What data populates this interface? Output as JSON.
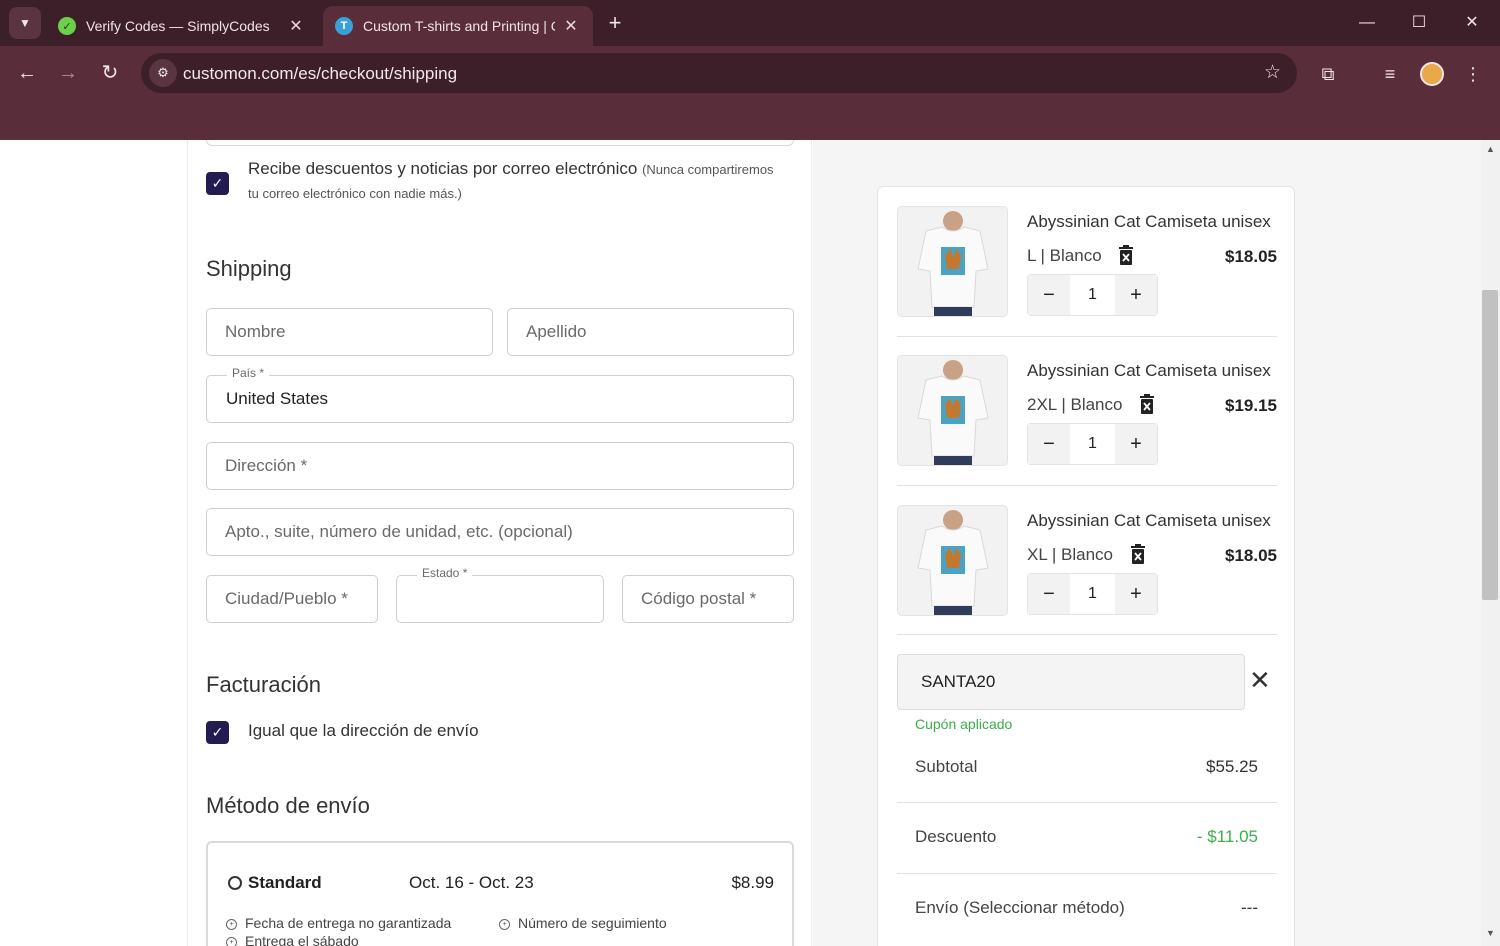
{
  "browser": {
    "tabs": [
      {
        "title": "Verify Codes — SimplyCodes",
        "close": "✕"
      },
      {
        "title": "Custom T-shirts and Printing | Custo",
        "close": "✕"
      }
    ],
    "new_tab": "+",
    "window": {
      "minimize": "—",
      "maximize": "☐",
      "close": "✕"
    },
    "url": "customon.com/es/checkout/shipping"
  },
  "form": {
    "newsletter": {
      "label": "Recibe descuentos y noticias por correo electrónico",
      "note_1": "(Nunca compartiremos",
      "note_2": "tu correo electrónico con nadie más.)"
    },
    "shipping_title": "Shipping",
    "first_name_placeholder": "Nombre",
    "last_name_placeholder": "Apellido",
    "country_legend": "País *",
    "country_value": "United States",
    "address_placeholder": "Dirección *",
    "address2_placeholder": "Apto., suite, número de unidad, etc. (opcional)",
    "city_placeholder": "Ciudad/Pueblo *",
    "state_legend": "Estado *",
    "state_value": "",
    "zip_placeholder": "Código postal *",
    "billing_title": "Facturación",
    "billing_same_label": "Igual que la dirección de envío",
    "method_title": "Método de envío",
    "method": {
      "name": "Standard",
      "dates": "Oct. 16 - Oct. 23",
      "price": "$8.99",
      "features": [
        "Fecha de entrega no garantizada",
        "Número de seguimiento",
        "Entrega el sábado"
      ]
    }
  },
  "cart": {
    "items": [
      {
        "name": "Abyssinian Cat Camiseta unisex",
        "variant": "L | Blanco",
        "price": "$18.05",
        "qty": "1"
      },
      {
        "name": "Abyssinian Cat Camiseta unisex",
        "variant": "2XL | Blanco",
        "price": "$19.15",
        "qty": "1"
      },
      {
        "name": "Abyssinian Cat Camiseta unisex",
        "variant": "XL | Blanco",
        "price": "$18.05",
        "qty": "1"
      }
    ],
    "stepper": {
      "minus": "−",
      "plus": "+"
    },
    "coupon_code": "SANTA20",
    "coupon_remove": "✕",
    "coupon_status": "Cupón aplicado",
    "subtotal_label": "Subtotal",
    "subtotal_value": "$55.25",
    "discount_label": "Descuento",
    "discount_value": "- $11.05",
    "shipping_label": "Envío (Seleccionar método)",
    "shipping_value": "---"
  },
  "colors": {
    "accent": "#231c52",
    "chrome": "#5a2d3b",
    "success": "#3cae4b"
  }
}
